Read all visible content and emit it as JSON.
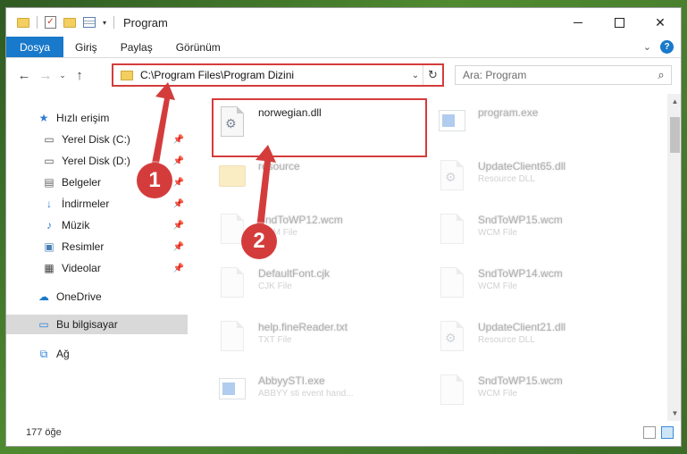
{
  "window": {
    "title": "Program"
  },
  "ribbon": {
    "tabs": [
      {
        "label": "Dosya"
      },
      {
        "label": "Giriş"
      },
      {
        "label": "Paylaş"
      },
      {
        "label": "Görünüm"
      }
    ],
    "help": "?"
  },
  "address": {
    "path": "C:\\Program Files\\Program Dizini",
    "refresh": "↻"
  },
  "search": {
    "placeholder": "Ara: Program"
  },
  "sidebar": {
    "items": [
      {
        "label": "Hızlı erişim",
        "icon": "star-icon"
      },
      {
        "label": "Yerel Disk (C:)",
        "icon": "drive-icon"
      },
      {
        "label": "Yerel Disk (D:)",
        "icon": "drive-icon"
      },
      {
        "label": "Belgeler",
        "icon": "documents-icon"
      },
      {
        "label": "İndirmeler",
        "icon": "download-icon"
      },
      {
        "label": "Müzik",
        "icon": "music-icon"
      },
      {
        "label": "Resimler",
        "icon": "pictures-icon"
      },
      {
        "label": "Videolar",
        "icon": "videos-icon"
      },
      {
        "label": "OneDrive",
        "icon": "cloud-icon"
      },
      {
        "label": "Bu bilgisayar",
        "icon": "computer-icon"
      },
      {
        "label": "Ağ",
        "icon": "network-icon"
      }
    ]
  },
  "files": [
    {
      "name": "norwegian.dll",
      "type": ""
    },
    {
      "name": "program.exe",
      "type": ""
    },
    {
      "name": "resource",
      "type": ""
    },
    {
      "name": "UpdateClient65.dll",
      "type": "Resource DLL"
    },
    {
      "name": "SndToWP12.wcm",
      "type": "WCM File"
    },
    {
      "name": "SndToWP15.wcm",
      "type": "WCM File"
    },
    {
      "name": "DefaultFont.cjk",
      "type": "CJK File"
    },
    {
      "name": "SndToWP14.wcm",
      "type": "WCM File"
    },
    {
      "name": "help.fineReader.txt",
      "type": "TXT File"
    },
    {
      "name": "UpdateClient21.dll",
      "type": "Resource DLL"
    },
    {
      "name": "AbbyySTI.exe",
      "type": "ABBYY sti event hand..."
    },
    {
      "name": "SndToWP15.wcm",
      "type": "WCM File"
    }
  ],
  "status": {
    "count": "177 öğe"
  },
  "annotations": {
    "step1": "1",
    "step2": "2"
  },
  "colors": {
    "accent": "#1979ca",
    "highlight": "#d43c3c"
  }
}
